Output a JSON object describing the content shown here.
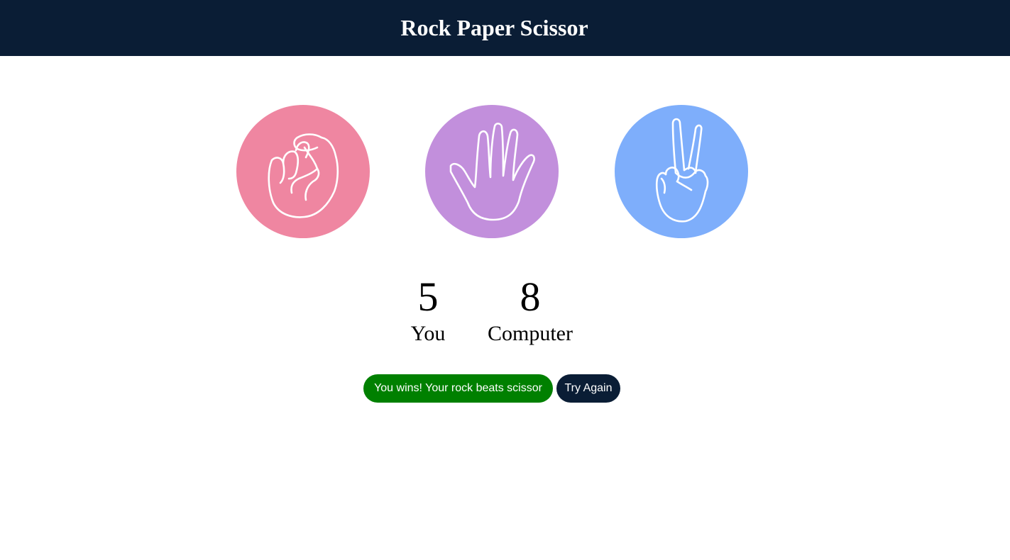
{
  "header": {
    "title": "Rock Paper Scissor"
  },
  "choices": [
    {
      "id": "rock",
      "icon": "rock-hand-icon",
      "color": "#ef86a1"
    },
    {
      "id": "paper",
      "icon": "paper-hand-icon",
      "color": "#c28fdc"
    },
    {
      "id": "scissor",
      "icon": "scissor-hand-icon",
      "color": "#7eaefb"
    }
  ],
  "scoreboard": {
    "user_score": "5",
    "user_label": "You",
    "computer_score": "8",
    "computer_label": "Computer"
  },
  "result": {
    "message": "You wins! Your rock beats scissor",
    "message_color": "#008000",
    "try_again_label": "Try Again"
  },
  "colors": {
    "header_bg": "#0a1d35",
    "button_bg": "#0a1d35"
  }
}
